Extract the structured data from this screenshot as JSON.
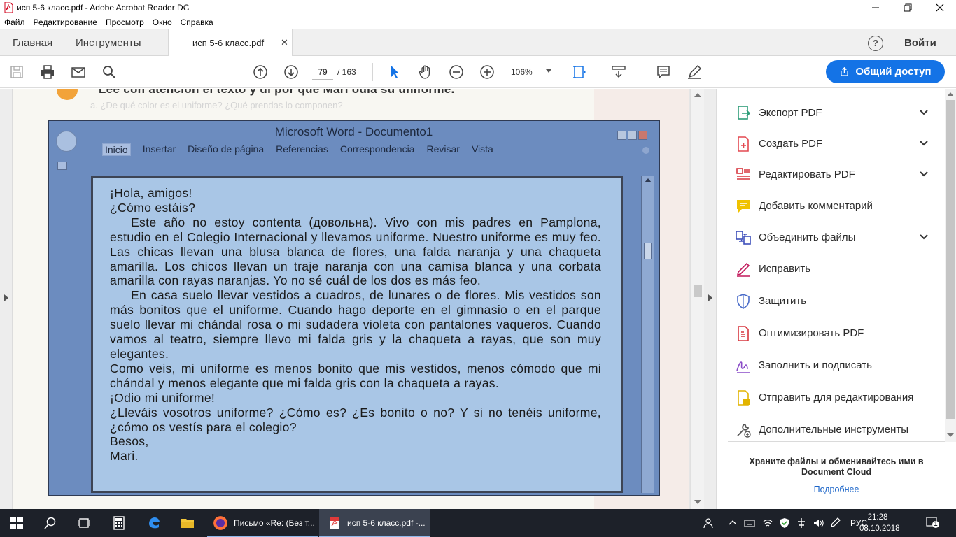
{
  "window": {
    "title": "исп 5-6 класс.pdf - Adobe Acrobat Reader DC"
  },
  "menu": [
    "Файл",
    "Редактирование",
    "Просмотр",
    "Окно",
    "Справка"
  ],
  "tabs": {
    "home": "Главная",
    "tools": "Инструменты",
    "document": "исп 5-6 класс.pdf",
    "help": "?",
    "signin": "Войти"
  },
  "toolbar": {
    "page_current": "79",
    "page_total": "/ 163",
    "zoom": "106%",
    "share_label": "Общий доступ"
  },
  "document": {
    "heading": "Lee con atención el texto y di por qué Mari odia su uniforme.",
    "ghost_line": "a. ¿De qué color es el uniforme? ¿Qué prendas lo componen?",
    "word_window": {
      "title": "Microsoft Word - Documento1",
      "ribbon": [
        "Inicio",
        "Insertar",
        "Diseño de página",
        "Referencias",
        "Correspondencia",
        "Revisar",
        "Vista"
      ],
      "lines": [
        {
          "text": "¡Hola, amigos!",
          "indent": false
        },
        {
          "text": "¿Cómo estáis?",
          "indent": false
        },
        {
          "text": "Este año no estoy contenta (довольна). Vivo con mis padres en Pamplona, estudio en el Colegio Internacional y llevamos uniforme. Nuestro uniforme es muy feo. Las chicas llevan una blusa blanca de flores, una falda naranja y una chaqueta amarilla. Los chicos llevan un traje naranja con una camisa blanca y una corbata amarilla con rayas naranjas. Yo no sé cuál de los dos es más feo.",
          "indent": true
        },
        {
          "text": "En casa suelo llevar vestidos a cuadros, de lunares o de flores. Mis vestidos son más bonitos que el uniforme. Cuando hago deporte en el gimnasio o en el parque suelo llevar mi chándal rosa o mi sudadera violeta con pantalones vaqueros. Cuando vamos al teatro, siempre llevo mi falda gris y la chaqueta a rayas, que son muy elegantes.",
          "indent": true
        },
        {
          "text": "Como veis, mi uniforme es menos bonito que mis vestidos, menos cómodo que mi chándal y menos elegante que mi falda gris con la chaqueta a rayas.",
          "indent": false
        },
        {
          "text": "¡Odio mi uniforme!",
          "indent": false
        },
        {
          "text": "¿Lleváis vosotros uniforme? ¿Cómo es? ¿Es bonito o no? Y si no tenéis uniforme, ¿cómo os vestís para el colegio?",
          "indent": false
        },
        {
          "text": "Besos,",
          "indent": false
        },
        {
          "text": "Mari.",
          "indent": false
        }
      ]
    }
  },
  "tools_pane": {
    "items": [
      {
        "label": "Экспорт PDF",
        "icon": "export-pdf-icon",
        "color": "#2d9d78",
        "expandable": true
      },
      {
        "label": "Создать PDF",
        "icon": "create-pdf-icon",
        "color": "#e34850",
        "expandable": true
      },
      {
        "label": "Редактировать PDF",
        "icon": "edit-pdf-icon",
        "color": "#d7373f",
        "expandable": true
      },
      {
        "label": "Добавить комментарий",
        "icon": "comment-icon",
        "color": "#f0c200",
        "expandable": false
      },
      {
        "label": "Объединить файлы",
        "icon": "combine-files-icon",
        "color": "#3d4fba",
        "expandable": true
      },
      {
        "label": "Исправить",
        "icon": "fix-icon",
        "color": "#c2185b",
        "expandable": false
      },
      {
        "label": "Защитить",
        "icon": "protect-icon",
        "color": "#4a6cc9",
        "expandable": false
      },
      {
        "label": "Оптимизировать PDF",
        "icon": "optimize-pdf-icon",
        "color": "#d7373f",
        "expandable": false
      },
      {
        "label": "Заполнить и подписать",
        "icon": "fill-sign-icon",
        "color": "#8a4cc8",
        "expandable": false
      },
      {
        "label": "Отправить для редактирования",
        "icon": "send-review-icon",
        "color": "#e2b400",
        "expandable": false
      },
      {
        "label": "Дополнительные инструменты",
        "icon": "more-tools-icon",
        "color": "#555555",
        "expandable": false
      }
    ],
    "cloud_text": "Храните файлы и обменивайтесь ими в Document Cloud",
    "cloud_link": "Подробнее"
  },
  "taskbar": {
    "apps": [
      {
        "label": "Письмо «Re: (Без т..."
      },
      {
        "label": "исп 5-6 класс.pdf -..."
      }
    ],
    "lang": "РУС",
    "time": "21:28",
    "date": "08.10.2018",
    "notifications": "1"
  },
  "colors": {
    "accent": "#1473e6",
    "word_frame": "#6c8cbf",
    "word_paper": "#a9c6e6",
    "taskbar": "#1d2129"
  }
}
